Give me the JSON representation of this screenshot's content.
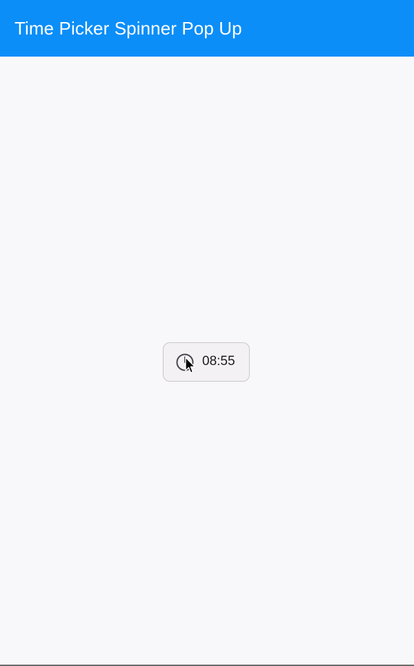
{
  "app_bar": {
    "title": "Time Picker Spinner Pop Up",
    "background": "#0b8ef8"
  },
  "time_button": {
    "time": "08:55",
    "icon": "clock-icon"
  },
  "cursor": {
    "icon": "mouse-pointer-icon"
  },
  "colors": {
    "background": "#f8f7fa",
    "button_border": "#c9c6cc"
  }
}
